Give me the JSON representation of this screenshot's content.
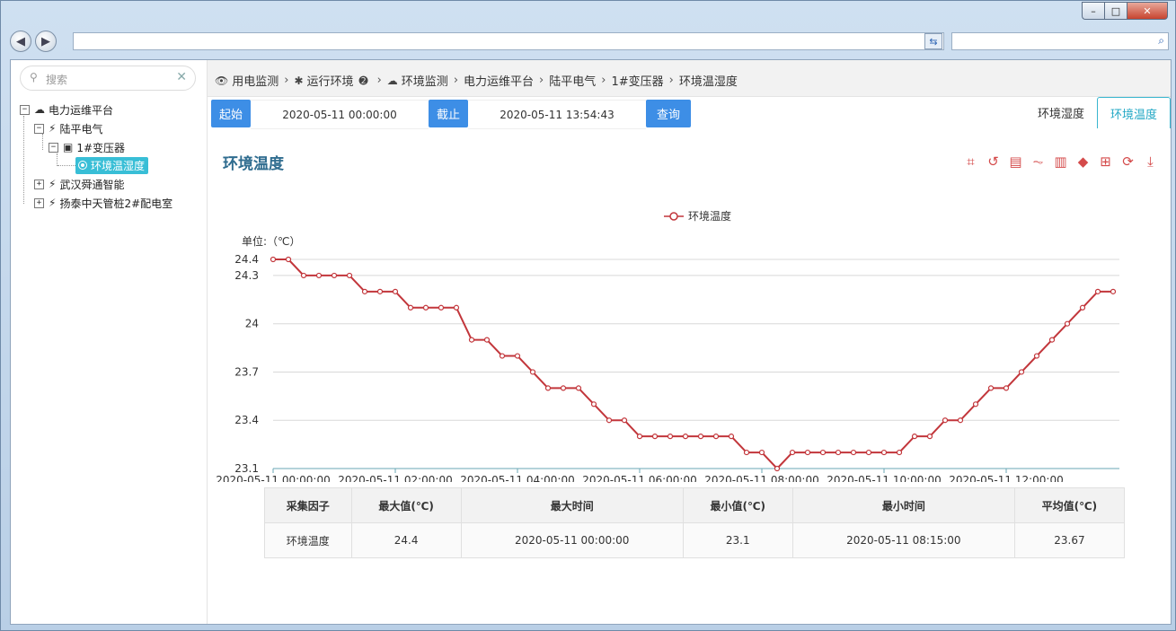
{
  "window": {
    "min_label": "–",
    "max_label": "□",
    "close_label": "✕"
  },
  "sidebar": {
    "search_placeholder": "搜索",
    "tree": {
      "root": "电力运维平台",
      "level1_a": "陆平电气",
      "level2_a": "1#变压器",
      "leaf_selected": "环境温湿度",
      "level1_b": "武汉舜通智能",
      "level1_c": "扬泰中天管桩2#配电室"
    }
  },
  "breadcrumb": {
    "items": [
      "用电监测",
      "运行环境",
      "环境监测",
      "电力运维平台",
      "陆平电气",
      "1#变压器",
      "环境温湿度"
    ]
  },
  "query": {
    "start_label": "起始",
    "start_value": "2020-05-11 00:00:00",
    "end_label": "截止",
    "end_value": "2020-05-11 13:54:43",
    "search_button": "查询"
  },
  "tabs": [
    "环境湿度",
    "环境温度"
  ],
  "active_tab": "环境温度",
  "chart": {
    "title": "环境温度",
    "unit_label": "单位:（℃）",
    "legend": "环境温度",
    "line_color": "#c2363b"
  },
  "chart_data": {
    "type": "line",
    "title": "环境温度",
    "ylabel": "单位:（℃）",
    "ylim": [
      23.1,
      24.4
    ],
    "y_ticks": [
      "24.4",
      "24.3",
      "24",
      "23.7",
      "23.4",
      "23.1"
    ],
    "x_ticks": [
      "2020-05-11 00:00:00",
      "2020-05-11 02:00:00",
      "2020-05-11 04:00:00",
      "2020-05-11 06:00:00",
      "2020-05-11 08:00:00",
      "2020-05-11 10:00:00",
      "2020-05-11 12:00:00"
    ],
    "x_start": "2020-05-11 00:00:00",
    "x_interval_minutes": 15,
    "series": [
      {
        "name": "环境温度",
        "values": [
          24.4,
          24.4,
          24.3,
          24.3,
          24.3,
          24.3,
          24.2,
          24.2,
          24.2,
          24.1,
          24.1,
          24.1,
          24.1,
          23.9,
          23.9,
          23.8,
          23.8,
          23.7,
          23.6,
          23.6,
          23.6,
          23.5,
          23.4,
          23.4,
          23.3,
          23.3,
          23.3,
          23.3,
          23.3,
          23.3,
          23.3,
          23.2,
          23.2,
          23.1,
          23.2,
          23.2,
          23.2,
          23.2,
          23.2,
          23.2,
          23.2,
          23.2,
          23.3,
          23.3,
          23.4,
          23.4,
          23.5,
          23.6,
          23.6,
          23.7,
          23.8,
          23.9,
          24.0,
          24.1,
          24.2,
          24.2
        ]
      }
    ]
  },
  "stats": {
    "headers": [
      "采集因子",
      "最大值(℃)",
      "最大时间",
      "最小值(℃)",
      "最小时间",
      "平均值(℃)"
    ],
    "rows": [
      [
        "环境温度",
        "24.4",
        "2020-05-11 00:00:00",
        "23.1",
        "2020-05-11 08:15:00",
        "23.67"
      ]
    ]
  }
}
